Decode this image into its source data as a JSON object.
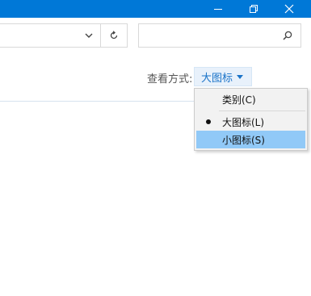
{
  "titlebar": {
    "color": "#0078d7",
    "minimize_icon": "minimize-icon",
    "restore_icon": "restore-icon",
    "close_icon": "close-icon"
  },
  "address_bar": {
    "dropdown_icon": "chevron-down-icon",
    "refresh_icon": "refresh-icon"
  },
  "search": {
    "value": "",
    "icon": "search-icon"
  },
  "view": {
    "label": "查看方式:",
    "selected": "大图标",
    "accent": "#1a73c8"
  },
  "view_menu": {
    "items": [
      {
        "label": "类别(C)",
        "checked": false,
        "highlighted": false
      },
      {
        "label": "大图标(L)",
        "checked": true,
        "highlighted": false
      },
      {
        "label": "小图标(S)",
        "checked": false,
        "highlighted": true
      }
    ],
    "highlight_color": "#91c9f7"
  }
}
